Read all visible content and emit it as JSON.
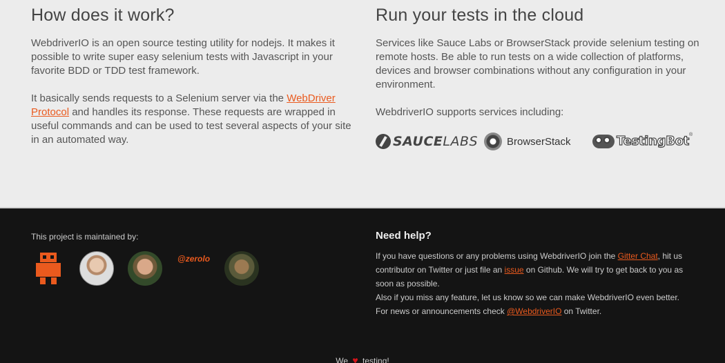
{
  "how": {
    "title": "How does it work?",
    "p1": "WebdriverIO is an open source testing utility for nodejs. It makes it possible to write super easy selenium tests with Javascript in your favorite BDD or TDD test framework.",
    "p2_before": "It basically sends requests to a Selenium server via the ",
    "p2_link": "WebDriver Protocol",
    "p2_after": " and handles its response. These requests are wrapped in useful commands and can be used to test several aspects of your site in an automated way."
  },
  "cloud": {
    "title": "Run your tests in the cloud",
    "p1": "Services like Sauce Labs or BrowserStack provide selenium testing on remote hosts. Be able to run tests on a wide collection of platforms, devices and browser combinations without any configuration in your environment.",
    "p2": "WebdriverIO supports services including:",
    "logos": {
      "sauce_bold": "SAUCE",
      "sauce_thin": "LABS",
      "browserstack": "BrowserStack",
      "testingbot": "TestingBot",
      "testingbot_reg": "®"
    }
  },
  "footer": {
    "maintained": "This project is maintained by:",
    "zerolo": "@zerolo",
    "help_title": "Need help?",
    "help_1": "If you have questions or any problems using WebdriverIO join the ",
    "help_gitter": "Gitter Chat",
    "help_2": ", hit us contributor on Twitter or just file an ",
    "help_issue": "issue",
    "help_3": " on Github. We will try to get back to you as soon as possible.",
    "help_4": "Also if you miss any feature, let us know so we can make WebdriverIO even better.",
    "help_5": "For news or announcements check ",
    "help_twitter": "@WebdriverIO",
    "help_6": " on Twitter.",
    "love_we": "We",
    "love_heart": "♥",
    "love_testing": "testing!"
  },
  "colors": {
    "accent": "#ea5a1e",
    "footer_bg": "#141414",
    "page_bg": "#ececec",
    "heart": "#d4151b"
  }
}
